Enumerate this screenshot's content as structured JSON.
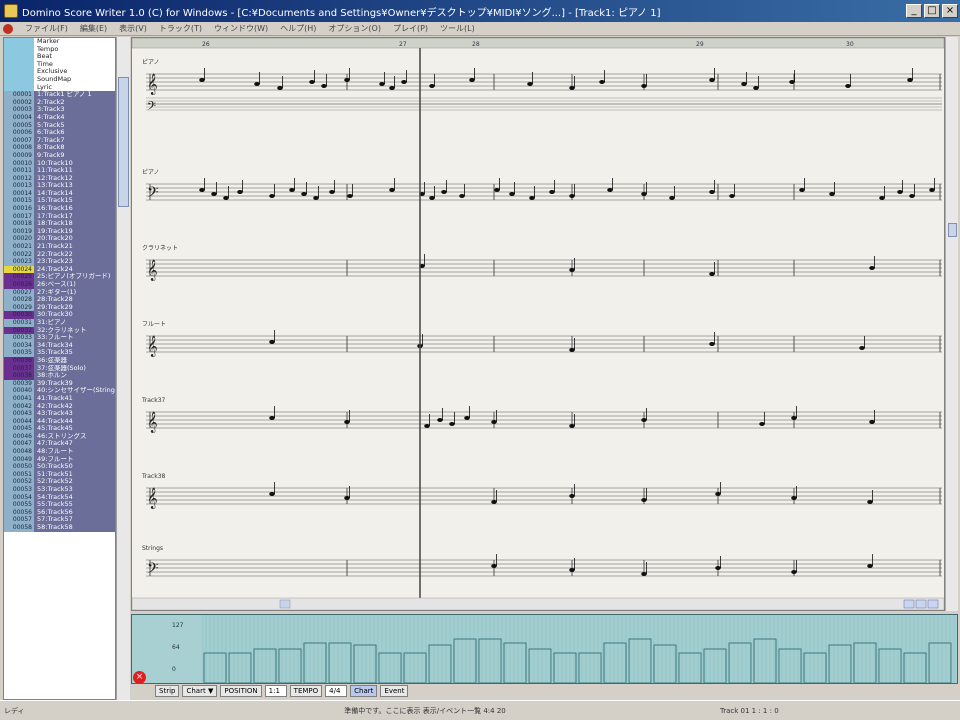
{
  "window": {
    "title": "Domino Score Writer 1.0 (C) for Windows - [C:¥Documents and Settings¥Owner¥デスクトップ¥MIDI¥ソング...] - [Track1: ピアノ 1]",
    "minimize": "_",
    "maximize": "□",
    "close": "×"
  },
  "menu": [
    "ファイル(F)",
    "編集(E)",
    "表示(V)",
    "トラック(T)",
    "ウィンドウ(W)",
    "ヘルプ(H)",
    "オプション(O)",
    "プレイ(P)",
    "ツール(L)"
  ],
  "tracklist": {
    "special": [
      {
        "num": "",
        "label": "Marker"
      },
      {
        "num": "",
        "label": "Tempo"
      },
      {
        "num": "",
        "label": "Beat"
      },
      {
        "num": "",
        "label": "Time"
      },
      {
        "num": "",
        "label": "Exclusive"
      },
      {
        "num": "",
        "label": "SoundMap"
      },
      {
        "num": "",
        "label": "Lyric"
      }
    ],
    "tracks": [
      {
        "num": "00001",
        "label": "1:Track1 ピアノ 1"
      },
      {
        "num": "00002",
        "label": "2:Track2"
      },
      {
        "num": "00003",
        "label": "3:Track3"
      },
      {
        "num": "00004",
        "label": "4:Track4"
      },
      {
        "num": "00005",
        "label": "5:Track5"
      },
      {
        "num": "00006",
        "label": "6:Track6"
      },
      {
        "num": "00007",
        "label": "7:Track7"
      },
      {
        "num": "00008",
        "label": "8:Track8"
      },
      {
        "num": "00009",
        "label": "9:Track9"
      },
      {
        "num": "00010",
        "label": "10:Track10"
      },
      {
        "num": "00011",
        "label": "11:Track11"
      },
      {
        "num": "00012",
        "label": "12:Track12"
      },
      {
        "num": "00013",
        "label": "13:Track13"
      },
      {
        "num": "00014",
        "label": "14:Track14"
      },
      {
        "num": "00015",
        "label": "15:Track15"
      },
      {
        "num": "00016",
        "label": "16:Track16"
      },
      {
        "num": "00017",
        "label": "17:Track17"
      },
      {
        "num": "00018",
        "label": "18:Track18"
      },
      {
        "num": "00019",
        "label": "19:Track19"
      },
      {
        "num": "00020",
        "label": "20:Track20"
      },
      {
        "num": "00021",
        "label": "21:Track21"
      },
      {
        "num": "00022",
        "label": "22:Track22"
      },
      {
        "num": "00023",
        "label": "23:Track23"
      },
      {
        "num": "00024",
        "label": "24:Track24"
      },
      {
        "num": "00025",
        "label": "25:ピアノ(オブリガード)"
      },
      {
        "num": "00026",
        "label": "26:ベース(1)"
      },
      {
        "num": "00027",
        "label": "27:ギター(1)"
      },
      {
        "num": "00028",
        "label": "28:Track28"
      },
      {
        "num": "00029",
        "label": "29:Track29"
      },
      {
        "num": "00030",
        "label": "30:Track30"
      },
      {
        "num": "00031",
        "label": "31:ピアノ"
      },
      {
        "num": "00032",
        "label": "32:クラリネット"
      },
      {
        "num": "00033",
        "label": "33:フルート"
      },
      {
        "num": "00034",
        "label": "34:Track34"
      },
      {
        "num": "00035",
        "label": "35:Track35"
      },
      {
        "num": "00036",
        "label": "36:弦楽器"
      },
      {
        "num": "00037",
        "label": "37:弦楽器(Solo)"
      },
      {
        "num": "00038",
        "label": "38:ホルン"
      },
      {
        "num": "00039",
        "label": "39:Track39"
      },
      {
        "num": "00040",
        "label": "40:シンセサイザー(Strings)"
      },
      {
        "num": "00041",
        "label": "41:Track41"
      },
      {
        "num": "00042",
        "label": "42:Track42"
      },
      {
        "num": "00043",
        "label": "43:Track43"
      },
      {
        "num": "00044",
        "label": "44:Track44"
      },
      {
        "num": "00045",
        "label": "45:Track45"
      },
      {
        "num": "00046",
        "label": "46:ストリングス"
      },
      {
        "num": "00047",
        "label": "47:Track47"
      },
      {
        "num": "00048",
        "label": "48:フルート"
      },
      {
        "num": "00049",
        "label": "49:フルート"
      },
      {
        "num": "00050",
        "label": "50:Track50"
      },
      {
        "num": "00051",
        "label": "51:Track51"
      },
      {
        "num": "00052",
        "label": "52:Track52"
      },
      {
        "num": "00053",
        "label": "53:Track53"
      },
      {
        "num": "00054",
        "label": "54:Track54"
      },
      {
        "num": "00055",
        "label": "55:Track55"
      },
      {
        "num": "00056",
        "label": "56:Track56"
      },
      {
        "num": "00057",
        "label": "57:Track57"
      },
      {
        "num": "00058",
        "label": "58:Track58"
      }
    ]
  },
  "score": {
    "measure_numbers": [
      "26",
      "27",
      "28",
      "29",
      "30"
    ],
    "staff_labels": [
      "ピアノ",
      "ピアノ",
      "クラリネット",
      "フルート",
      "Track37",
      "Track38",
      "Strings"
    ]
  },
  "graph": {
    "axis_labels": [
      "127",
      "64",
      "0"
    ]
  },
  "controls": {
    "mode": "Strip",
    "channel": "Chart",
    "position_label": "POSITION",
    "position_value": "1:1",
    "tempo_label": "TEMPO",
    "tempo_value": "4/4",
    "chart_button": "Chart",
    "event_button": "Event"
  },
  "statusbar": {
    "left": "レディ",
    "middle": "準備中です。ここに表示 表示/イベント一覧  4:4  20",
    "right": "Track 01   1 : 1 : 0"
  }
}
